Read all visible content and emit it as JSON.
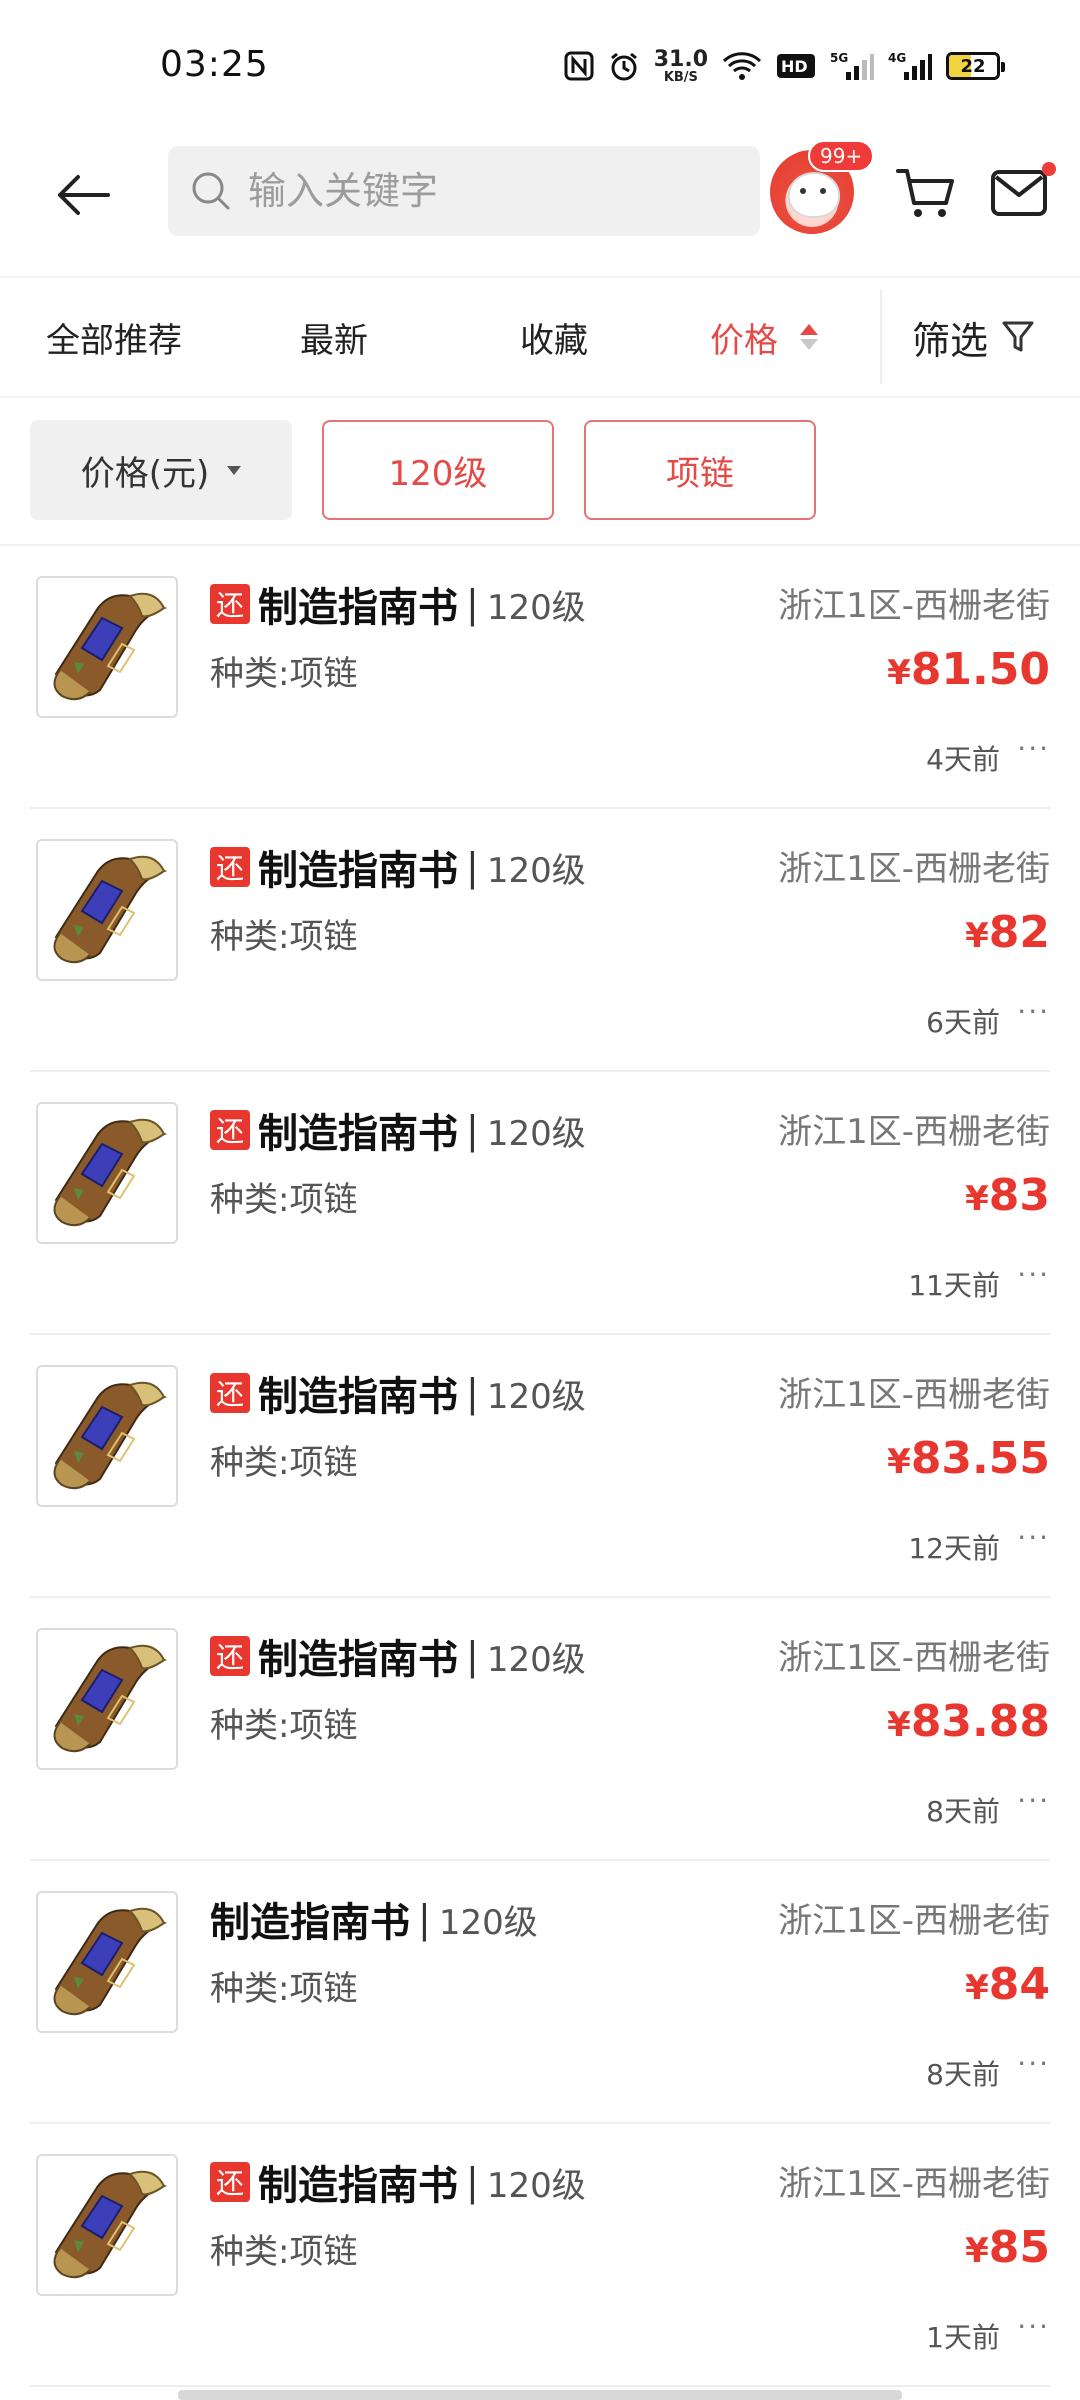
{
  "status_bar": {
    "time": "03:25",
    "net_speed_value": "31.0",
    "net_speed_unit": "KB/S",
    "signal_5g": "5G",
    "signal_4g": "4G",
    "battery": "22",
    "icons": [
      "nfc-icon",
      "alarm-icon",
      "wifi-icon",
      "hd-icon",
      "signal-5g-icon",
      "signal-4g-icon",
      "battery-icon"
    ]
  },
  "header": {
    "search_placeholder": "输入关键字",
    "avatar_badge": "99+",
    "accent_color": "#e64a46"
  },
  "tabs": [
    {
      "label": "全部推荐",
      "active": false
    },
    {
      "label": "最新",
      "active": false
    },
    {
      "label": "收藏",
      "active": false
    },
    {
      "label": "价格",
      "active": true
    }
  ],
  "filter_label": "筛选",
  "chips": [
    {
      "label": "价格(元)",
      "style": "dropdown"
    },
    {
      "label": "120级",
      "style": "selected"
    },
    {
      "label": "项链",
      "style": "selected"
    }
  ],
  "items": [
    {
      "tag": "还",
      "name": "制造指南书",
      "level": "120级",
      "kind": "种类:项链",
      "server": "浙江1区-西栅老街",
      "currency": "¥",
      "price": "81.50",
      "time": "4天前"
    },
    {
      "tag": "还",
      "name": "制造指南书",
      "level": "120级",
      "kind": "种类:项链",
      "server": "浙江1区-西栅老街",
      "currency": "¥",
      "price": "82",
      "time": "6天前"
    },
    {
      "tag": "还",
      "name": "制造指南书",
      "level": "120级",
      "kind": "种类:项链",
      "server": "浙江1区-西栅老街",
      "currency": "¥",
      "price": "83",
      "time": "11天前"
    },
    {
      "tag": "还",
      "name": "制造指南书",
      "level": "120级",
      "kind": "种类:项链",
      "server": "浙江1区-西栅老街",
      "currency": "¥",
      "price": "83.55",
      "time": "12天前"
    },
    {
      "tag": "还",
      "name": "制造指南书",
      "level": "120级",
      "kind": "种类:项链",
      "server": "浙江1区-西栅老街",
      "currency": "¥",
      "price": "83.88",
      "time": "8天前"
    },
    {
      "tag": "",
      "name": "制造指南书",
      "level": "120级",
      "kind": "种类:项链",
      "server": "浙江1区-西栅老街",
      "currency": "¥",
      "price": "84",
      "time": "8天前"
    },
    {
      "tag": "还",
      "name": "制造指南书",
      "level": "120级",
      "kind": "种类:项链",
      "server": "浙江1区-西栅老街",
      "currency": "¥",
      "price": "85",
      "time": "1天前"
    }
  ],
  "separator": "|",
  "more_label": "···"
}
